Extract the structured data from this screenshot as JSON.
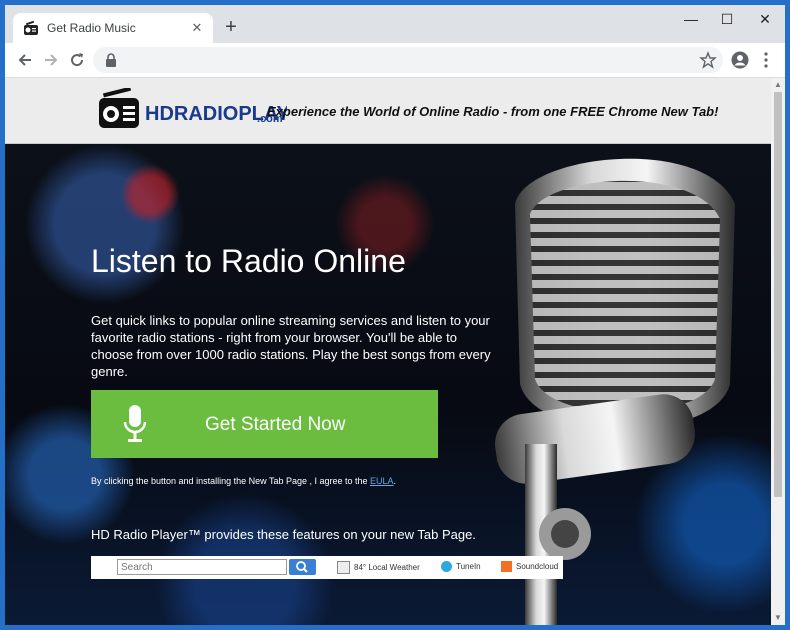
{
  "browser": {
    "tab_title": "Get Radio Music",
    "tab_close": "✕",
    "new_tab": "+",
    "minimize": "—",
    "maximize": "☐",
    "close": "✕"
  },
  "header": {
    "logo_text_hd": "HDRADIOPLAYER",
    "logo_text_com": ".com",
    "tagline": "Experience the World of Online Radio - from one FREE Chrome New Tab!"
  },
  "hero": {
    "headline": "Listen to Radio Online",
    "description": "Get quick links to popular online streaming services and listen to your favorite radio stations - right from your browser. You'll be able to choose from over 1000 radio stations. Play the best songs from every genre.",
    "cta_label": "Get Started Now",
    "terms_prefix": "By clicking the button and installing the New Tab Page , I agree to the ",
    "terms_link": "EULA",
    "terms_suffix": ".",
    "features_text": "HD Radio Player™ provides these features on your new Tab Page."
  },
  "preview_bar": {
    "search_placeholder": "Search",
    "weather": "84° Local Weather",
    "tunein": "TuneIn",
    "soundcloud": "Soundcloud"
  },
  "colors": {
    "cta_green": "#6abd3f",
    "frame_blue": "#2470c8",
    "search_blue": "#3a7fd6"
  }
}
